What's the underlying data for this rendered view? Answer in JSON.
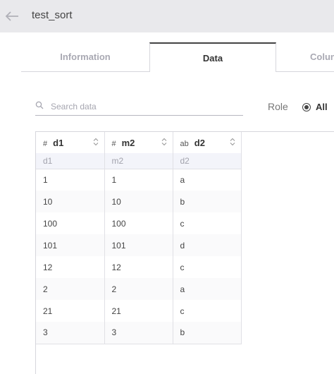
{
  "header": {
    "title": "test_sort",
    "back_icon": "arrow-left-icon"
  },
  "tabs": [
    {
      "label": "Information",
      "active": false
    },
    {
      "label": "Data",
      "active": true
    },
    {
      "label": "Colun",
      "active": false
    }
  ],
  "search": {
    "placeholder": "Search data",
    "value": ""
  },
  "role": {
    "label": "Role",
    "selected_option": "All"
  },
  "grid": {
    "columns": [
      {
        "type_mark": "#",
        "name": "d1",
        "sub": "d1"
      },
      {
        "type_mark": "#",
        "name": "m2",
        "sub": "m2"
      },
      {
        "type_mark": "ab",
        "name": "d2",
        "sub": "d2"
      }
    ],
    "rows": [
      [
        "1",
        "1",
        "a"
      ],
      [
        "10",
        "10",
        "b"
      ],
      [
        "100",
        "100",
        "c"
      ],
      [
        "101",
        "101",
        "d"
      ],
      [
        "12",
        "12",
        "c"
      ],
      [
        "2",
        "2",
        "a"
      ],
      [
        "21",
        "21",
        "c"
      ],
      [
        "3",
        "3",
        "b"
      ]
    ]
  },
  "colors": {
    "topbar_bg": "#e9e9ec",
    "active_tab_border": "#444444",
    "subheader_bg": "#f3f4fa"
  }
}
